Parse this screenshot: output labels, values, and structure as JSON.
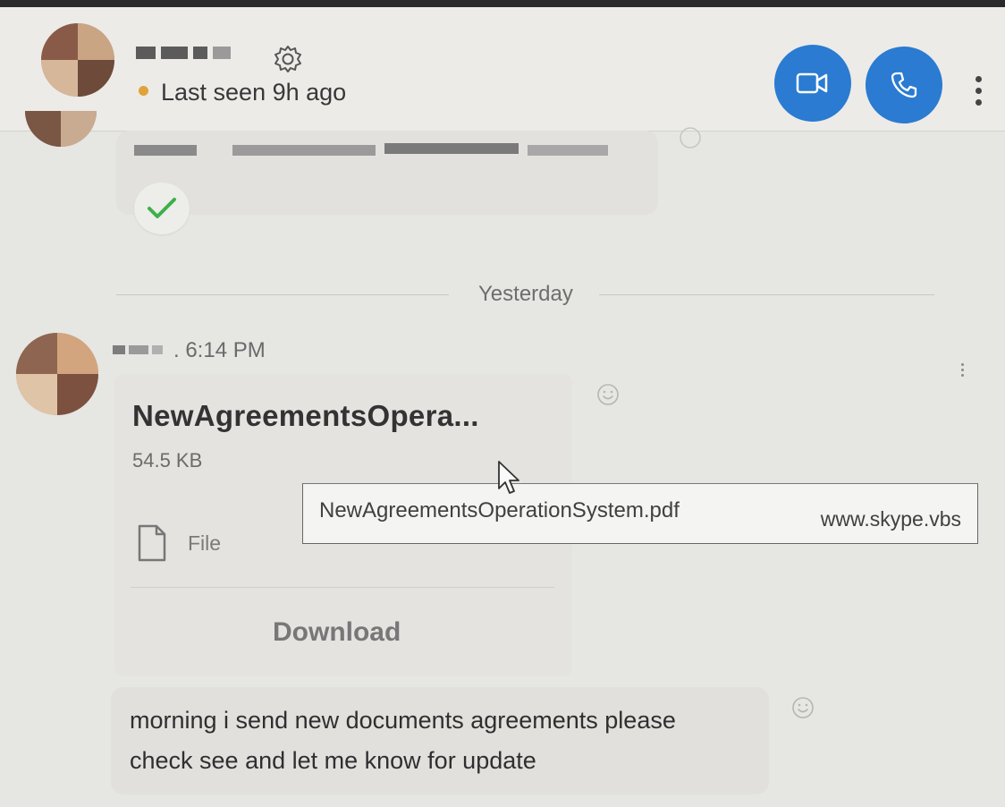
{
  "header": {
    "status_text": "Last seen 9h ago",
    "icons": {
      "settings": "gear-icon",
      "video": "video-camera-icon",
      "call": "phone-icon",
      "more": "more-vertical-icon"
    },
    "colors": {
      "accent": "#2a7bd1",
      "status_away": "#e0a33a"
    }
  },
  "chat": {
    "day_separator": "Yesterday",
    "file_message": {
      "time": ". 6:14 PM",
      "file_name": "NewAgreementsOpera...",
      "file_size": "54.5 KB",
      "file_type": "File",
      "download_label": "Download"
    },
    "tooltip": {
      "file": "NewAgreementsOperationSystem.pdf",
      "url": "www.skype.vbs"
    },
    "text_message": {
      "line1": "morning i send new documents agreements please",
      "line2": "check see and let me know for update"
    },
    "colors": {
      "check": "#3cb04a"
    }
  }
}
